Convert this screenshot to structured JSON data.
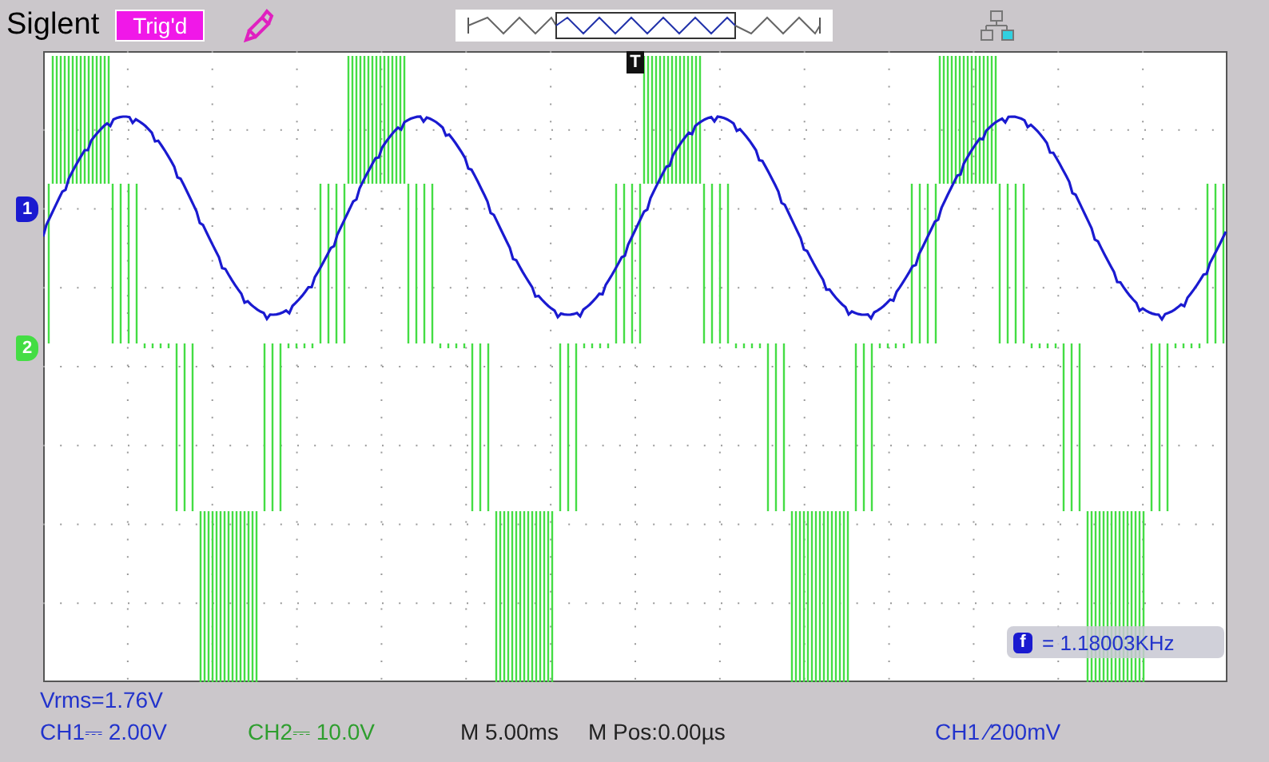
{
  "header": {
    "brand": "Siglent",
    "trigger_status": "Trig'd"
  },
  "channel_markers": [
    {
      "label": "1",
      "color": "#1a1ad0"
    },
    {
      "label": "2",
      "color": "#44dd44"
    }
  ],
  "trigger_marker": "T",
  "frequency": {
    "icon_label": "f",
    "reading": "= 1.18003KHz"
  },
  "measurement": "Vrms=1.76V",
  "status_bar": [
    {
      "text": "CH1⎓ 2.00V",
      "color": "#2233cc"
    },
    {
      "text": "CH2⎓ 10.0V",
      "color": "#2e9e2e"
    },
    {
      "text": "M 5.00ms",
      "color": "#222222"
    },
    {
      "text": "M Pos:0.00µs",
      "color": "#222222"
    },
    {
      "text": "CH1 ⁄200mV",
      "color": "#2233cc"
    }
  ]
}
